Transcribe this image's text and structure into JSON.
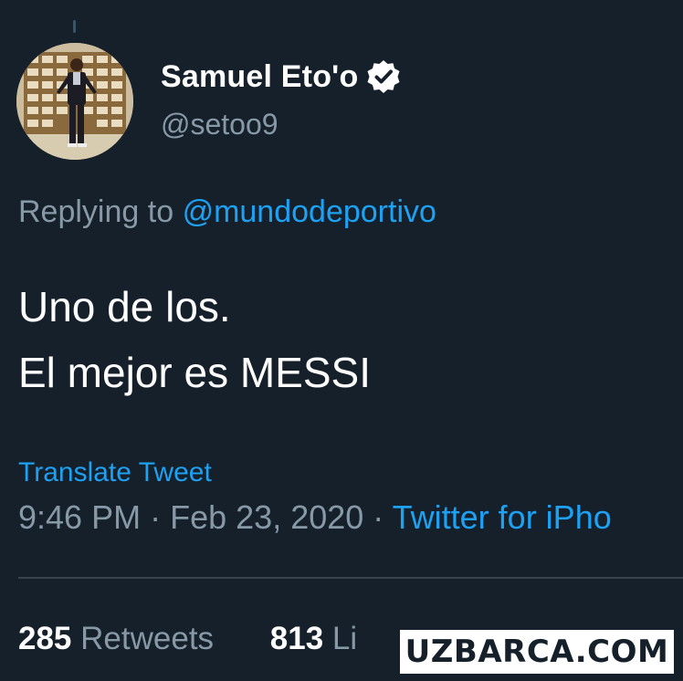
{
  "tweet": {
    "author": {
      "display_name": "Samuel Eto'o",
      "handle": "@setoo9",
      "verified": true
    },
    "replying_prefix": "Replying to",
    "replying_to": "@mundodeportivo",
    "text_lines": [
      "Uno de los.",
      "El mejor es MESSI"
    ],
    "translate_label": "Translate Tweet",
    "time": "9:46 PM",
    "separator": "·",
    "date": "Feb 23, 2020",
    "source": "Twitter for iPho",
    "stats": {
      "retweets_count": "285",
      "retweets_label": "Retweets",
      "likes_count": "813",
      "likes_label": "Li"
    }
  },
  "watermark": "UZBARCA.COM",
  "colors": {
    "background": "#15202b",
    "primary_text": "#ffffff",
    "secondary_text": "#8899a6",
    "accent": "#1da1f2",
    "divider": "#38444d"
  },
  "icons": {
    "verified": "verified-badge-icon",
    "avatar": "profile-photo"
  }
}
